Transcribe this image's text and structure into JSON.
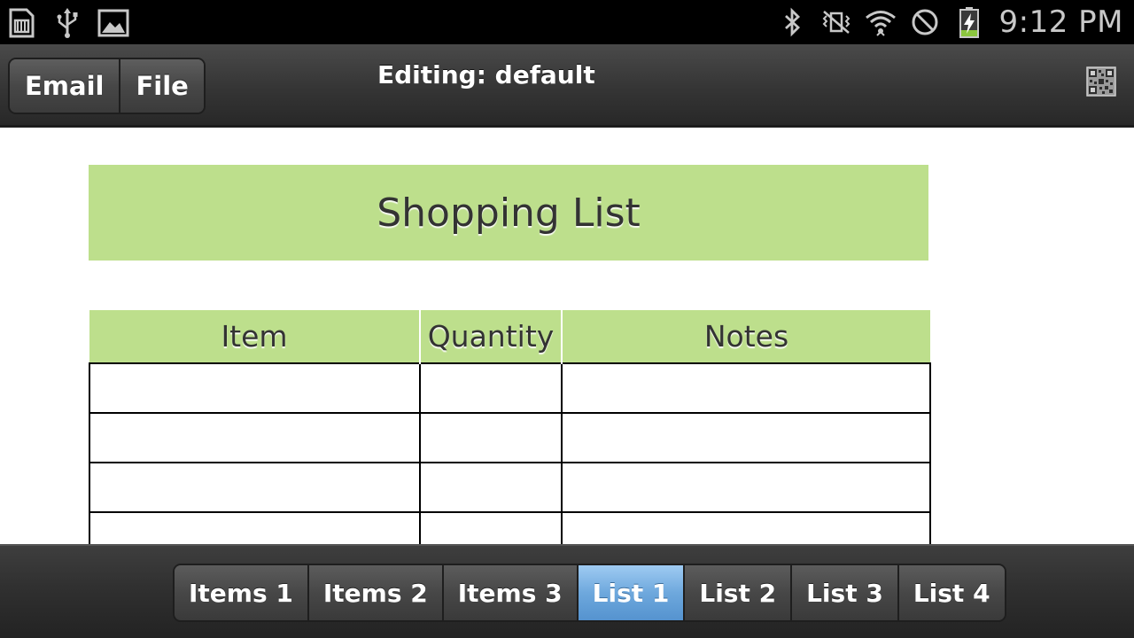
{
  "status_bar": {
    "left_icons": [
      "sd-card-icon",
      "usb-icon",
      "image-icon"
    ],
    "right_icons": [
      "bluetooth-icon",
      "vibrate-icon",
      "wifi-icon",
      "no-sign-icon",
      "battery-charging-icon"
    ],
    "time": "9:12 PM"
  },
  "action_bar": {
    "buttons": [
      {
        "label": "Email"
      },
      {
        "label": "File"
      }
    ],
    "title": "Editing: default",
    "tool_icon": "qr-code-icon"
  },
  "document": {
    "title": "Shopping List",
    "columns": [
      "Item",
      "Quantity",
      "Notes"
    ],
    "rows": [
      [
        "",
        "",
        ""
      ],
      [
        "",
        "",
        ""
      ],
      [
        "",
        "",
        ""
      ],
      [
        "",
        "",
        ""
      ]
    ],
    "header_color": "#bddf8c"
  },
  "bottom_tabs": {
    "tabs": [
      {
        "label": "Items 1",
        "active": false
      },
      {
        "label": "Items 2",
        "active": false
      },
      {
        "label": "Items 3",
        "active": false
      },
      {
        "label": "List 1",
        "active": true
      },
      {
        "label": "List 2",
        "active": false
      },
      {
        "label": "List 3",
        "active": false
      },
      {
        "label": "List 4",
        "active": false
      }
    ],
    "active_color": "#6ea8dd"
  }
}
